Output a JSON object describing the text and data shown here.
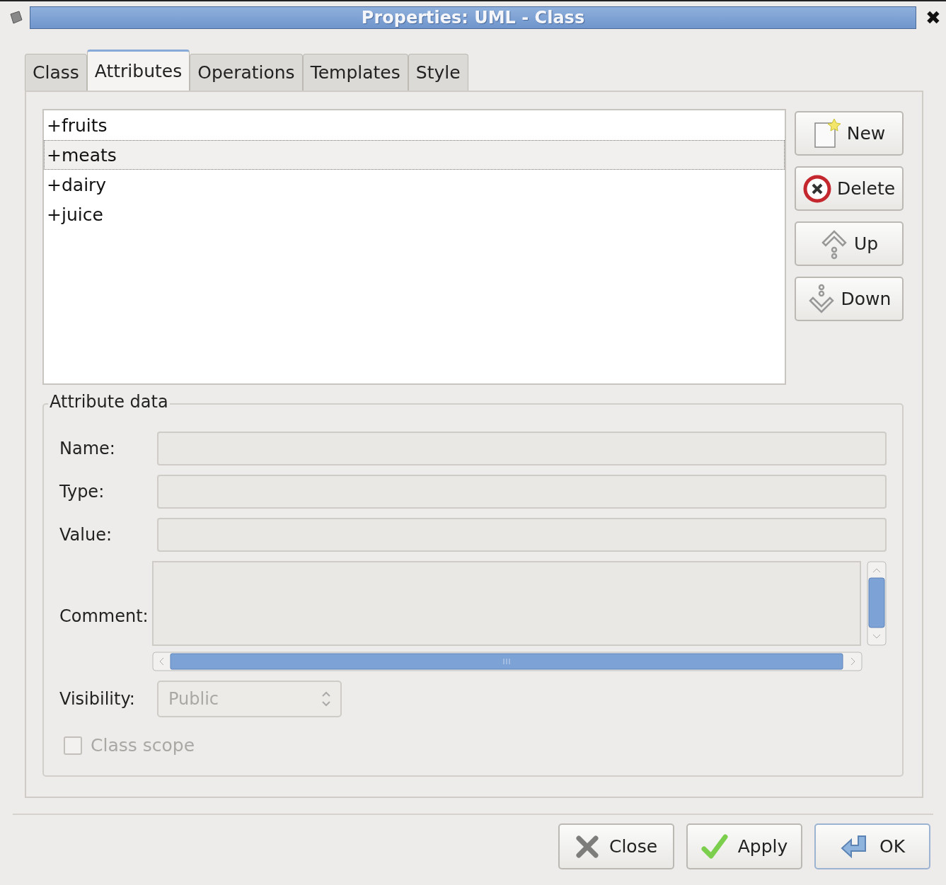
{
  "window": {
    "title": "Properties: UML - Class",
    "close": "✖"
  },
  "tabs": [
    {
      "label": "Class",
      "selected": false
    },
    {
      "label": "Attributes",
      "selected": true
    },
    {
      "label": "Operations",
      "selected": false
    },
    {
      "label": "Templates",
      "selected": false
    },
    {
      "label": "Style",
      "selected": false
    }
  ],
  "attributes": [
    {
      "label": "+fruits",
      "selected": false
    },
    {
      "label": "+meats",
      "selected": true
    },
    {
      "label": "+dairy",
      "selected": false
    },
    {
      "label": "+juice",
      "selected": false
    }
  ],
  "side_buttons": [
    {
      "kind": "new",
      "label": "New"
    },
    {
      "kind": "delete",
      "label": "Delete"
    },
    {
      "kind": "up",
      "label": "Up"
    },
    {
      "kind": "down",
      "label": "Down"
    }
  ],
  "attribute_data": {
    "title": "Attribute data",
    "fields": [
      {
        "label": "Name:",
        "disabled": true
      },
      {
        "label": "Type:",
        "disabled": true
      },
      {
        "label": "Value:",
        "disabled": true
      }
    ],
    "comment": {
      "label": "Comment:",
      "disabled": true
    },
    "visibility": {
      "label": "Visibility:",
      "value": "Public",
      "disabled": true
    },
    "class_scope": {
      "label": "Class scope",
      "checked": false,
      "disabled": true
    }
  },
  "buttons": [
    {
      "kind": "close",
      "label": "Close",
      "default": false
    },
    {
      "kind": "apply",
      "label": "Apply",
      "default": false
    },
    {
      "kind": "ok",
      "label": "OK",
      "default": true
    }
  ]
}
